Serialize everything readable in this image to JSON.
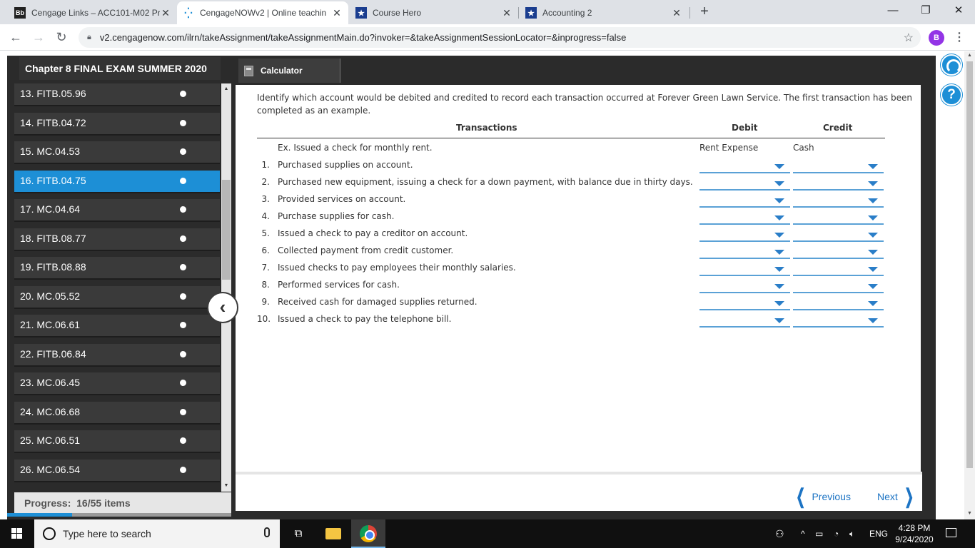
{
  "browser": {
    "tabs": [
      {
        "title": "Cengage Links – ACC101-M02 Pr",
        "favicon": "Bb",
        "active": false
      },
      {
        "title": "CengageNOWv2 | Online teachin",
        "favicon": "cengage-dots-icon",
        "active": true
      },
      {
        "title": "Course Hero",
        "favicon": "star-badge-icon",
        "active": false
      },
      {
        "title": "Accounting 2",
        "favicon": "star-badge-icon",
        "active": false
      }
    ],
    "url": "v2.cengagenow.com/ilrn/takeAssignment/takeAssignmentMain.do?invoker=&takeAssignmentSessionLocator=&inprogress=false",
    "profile_initial": "B"
  },
  "assignment": {
    "title": "Chapter 8 FINAL EXAM SUMMER 2020",
    "calculator_label": "Calculator",
    "questions": [
      {
        "label": "13. FITB.05.96"
      },
      {
        "label": "14. FITB.04.72"
      },
      {
        "label": "15. MC.04.53"
      },
      {
        "label": "16. FITB.04.75",
        "active": true
      },
      {
        "label": "17. MC.04.64"
      },
      {
        "label": "18. FITB.08.77"
      },
      {
        "label": "19. FITB.08.88"
      },
      {
        "label": "20. MC.05.52"
      },
      {
        "label": "21. MC.06.61"
      },
      {
        "label": "22. FITB.06.84"
      },
      {
        "label": "23. MC.06.45"
      },
      {
        "label": "24. MC.06.68"
      },
      {
        "label": "25. MC.06.51"
      },
      {
        "label": "26. MC.06.54"
      }
    ],
    "progress_label": "Progress:",
    "progress_value": "16/55 items",
    "progress_fraction": 0.29
  },
  "question": {
    "prompt": "Identify which account would be debited and credited to record each transaction occurred at Forever Green Lawn Service. The first transaction has been completed as an example.",
    "headers": {
      "transactions": "Transactions",
      "debit": "Debit",
      "credit": "Credit"
    },
    "example": {
      "text": "Ex. Issued a check for monthly rent.",
      "debit": "Rent Expense",
      "credit": "Cash"
    },
    "rows": [
      {
        "num": "1.",
        "text": "Purchased supplies on account.",
        "debit": "",
        "credit": ""
      },
      {
        "num": "2.",
        "text": "Purchased new equipment, issuing a check for a down payment, with balance due in thirty days.",
        "debit": "",
        "credit": ""
      },
      {
        "num": "3.",
        "text": "Provided services on account.",
        "debit": "",
        "credit": ""
      },
      {
        "num": "4.",
        "text": "Purchase supplies for cash.",
        "debit": "",
        "credit": ""
      },
      {
        "num": "5.",
        "text": "Issued a check to pay a creditor on account.",
        "debit": "",
        "credit": ""
      },
      {
        "num": "6.",
        "text": "Collected payment from credit customer.",
        "debit": "",
        "credit": ""
      },
      {
        "num": "7.",
        "text": "Issued checks to pay employees their monthly salaries.",
        "debit": "",
        "credit": ""
      },
      {
        "num": "8.",
        "text": "Performed services for cash.",
        "debit": "",
        "credit": ""
      },
      {
        "num": "9.",
        "text": "Received cash for damaged supplies returned.",
        "debit": "",
        "credit": ""
      },
      {
        "num": "10.",
        "text": "Issued a check to pay the telephone bill.",
        "debit": "",
        "credit": ""
      }
    ]
  },
  "nav": {
    "previous": "Previous",
    "next": "Next"
  },
  "taskbar": {
    "search_placeholder": "Type here to search",
    "language": "ENG",
    "time": "4:28 PM",
    "date": "9/24/2020"
  },
  "colors": {
    "accent": "#1d8fd6",
    "link": "#1d74c4",
    "frame": "#2b2b2b"
  }
}
